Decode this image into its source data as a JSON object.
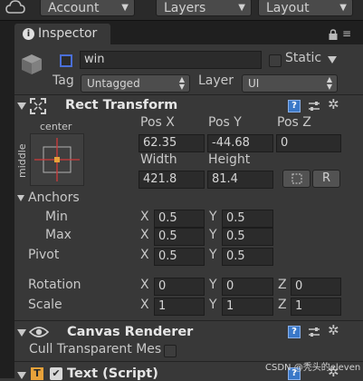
{
  "toolbar": {
    "account": "Account",
    "layers": "Layers",
    "layout": "Layout"
  },
  "tab": {
    "label": "Inspector"
  },
  "object": {
    "name": "win",
    "static_label": "Static",
    "tag_label": "Tag",
    "tag_value": "Untagged",
    "layer_label": "Layer",
    "layer_value": "UI"
  },
  "rect_transform": {
    "title": "Rect Transform",
    "anchor_top": "center",
    "anchor_side": "middle",
    "pos_x_label": "Pos X",
    "pos_y_label": "Pos Y",
    "pos_z_label": "Pos Z",
    "pos_x": "62.35",
    "pos_y": "-44.68",
    "pos_z": "0",
    "width_label": "Width",
    "height_label": "Height",
    "width": "421.8",
    "height": "81.4",
    "r_button": "R",
    "anchors_label": "Anchors",
    "min_label": "Min",
    "max_label": "Max",
    "min_x": "0.5",
    "min_y": "0.5",
    "max_x": "0.5",
    "max_y": "0.5",
    "pivot_label": "Pivot",
    "pivot_x": "0.5",
    "pivot_y": "0.5",
    "rotation_label": "Rotation",
    "rot_x": "0",
    "rot_y": "0",
    "rot_z": "0",
    "scale_label": "Scale",
    "scale_x": "1",
    "scale_y": "1",
    "scale_z": "1",
    "x": "X",
    "y": "Y",
    "z": "Z"
  },
  "canvas_renderer": {
    "title": "Canvas Renderer",
    "cull_label": "Cull Transparent Mes"
  },
  "text_script": {
    "title": "Text (Script)"
  },
  "watermark": "CSDN @秃头的eleven",
  "colors": {
    "background": "#383838",
    "field": "#2b2b2b",
    "header_dark": "#1f1f1f",
    "help_blue": "#3a78c8"
  }
}
